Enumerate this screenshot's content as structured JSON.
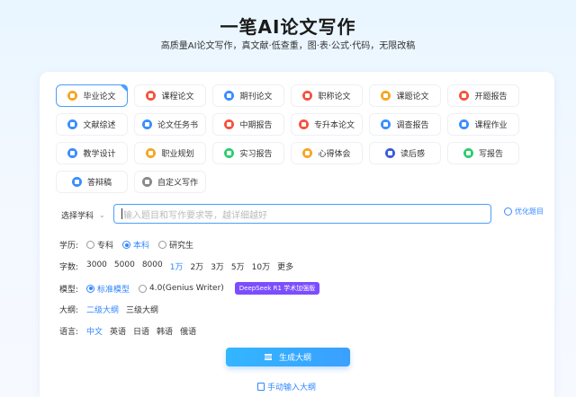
{
  "header": {
    "title": "一笔AI论文写作",
    "subtitle": "高质量AI论文写作，真文献·低查重，图·表·公式·代码，无限改稿"
  },
  "categories": [
    {
      "label": "毕业论文",
      "icon": "graduation-cap-icon",
      "color": "#f5a623",
      "active": true
    },
    {
      "label": "课程论文",
      "icon": "book-icon",
      "color": "#f5533d",
      "active": false
    },
    {
      "label": "期刊论文",
      "icon": "journal-icon",
      "color": "#3a8dff",
      "active": false
    },
    {
      "label": "职称论文",
      "icon": "certificate-icon",
      "color": "#f5533d",
      "active": false
    },
    {
      "label": "课题论文",
      "icon": "topic-icon",
      "color": "#f5a623",
      "active": false
    },
    {
      "label": "开题报告",
      "icon": "report-icon",
      "color": "#f5533d",
      "active": false
    },
    {
      "label": "文献综述",
      "icon": "literature-icon",
      "color": "#3a8dff",
      "active": false
    },
    {
      "label": "论文任务书",
      "icon": "task-icon",
      "color": "#3a8dff",
      "active": false
    },
    {
      "label": "中期报告",
      "icon": "midterm-icon",
      "color": "#f5533d",
      "active": false
    },
    {
      "label": "专升本论文",
      "icon": "upgrade-icon",
      "color": "#f5533d",
      "active": false
    },
    {
      "label": "调查报告",
      "icon": "survey-icon",
      "color": "#3a8dff",
      "active": false
    },
    {
      "label": "课程作业",
      "icon": "homework-icon",
      "color": "#3a8dff",
      "active": false
    },
    {
      "label": "教学设计",
      "icon": "tools-icon",
      "color": "#3a8dff",
      "active": false
    },
    {
      "label": "职业规划",
      "icon": "career-icon",
      "color": "#f5a623",
      "active": false
    },
    {
      "label": "实习报告",
      "icon": "internship-icon",
      "color": "#2ecc71",
      "active": false
    },
    {
      "label": "心得体会",
      "icon": "insight-icon",
      "color": "#f5a623",
      "active": false
    },
    {
      "label": "读后感",
      "icon": "reading-icon",
      "color": "#3a5bd9",
      "active": false
    },
    {
      "label": "写报告",
      "icon": "write-report-icon",
      "color": "#2ecc71",
      "active": false
    },
    {
      "label": "答辩稿",
      "icon": "defense-icon",
      "color": "#3a8dff",
      "active": false
    },
    {
      "label": "自定义写作",
      "icon": "custom-write-icon",
      "color": "#888888",
      "active": false
    }
  ],
  "form": {
    "subject_select": "选择学科",
    "topic_placeholder": "输入题目和写作要求等，越详细越好",
    "optimize_label": "优化题目",
    "education": {
      "label": "学历:",
      "options": [
        "专科",
        "本科",
        "研究生"
      ],
      "selected": "本科"
    },
    "wordcount": {
      "label": "字数:",
      "options": [
        "3000",
        "5000",
        "8000",
        "1万",
        "2万",
        "3万",
        "5万",
        "10万",
        "更多"
      ],
      "selected": "1万"
    },
    "model": {
      "label": "模型:",
      "options": [
        "标准模型",
        "4.0(Genius Writer)"
      ],
      "selected": "标准模型",
      "badge": "DeepSeek R1 学术加强版"
    },
    "outline": {
      "label": "大纲:",
      "options": [
        "二级大纲",
        "三级大纲"
      ],
      "selected": "二级大纲"
    },
    "language": {
      "label": "语言:",
      "options": [
        "中文",
        "英语",
        "日语",
        "韩语",
        "俄语"
      ],
      "selected": "中文"
    },
    "generate_button": "生成大纲",
    "manual_link": "手动输入大纲"
  },
  "colors": {
    "accent": "#2f86ff",
    "badge": "#7b4dff"
  }
}
